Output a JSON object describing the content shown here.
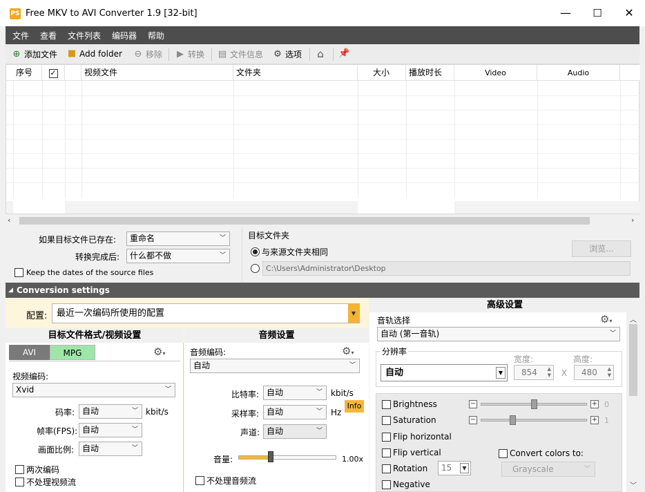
{
  "window": {
    "title": "Free MKV to AVI Converter 1.9  [32-bit]",
    "icon_text": "PS",
    "minimize": "—",
    "maximize": "☐",
    "close": "✕"
  },
  "menu": [
    "文件",
    "查看",
    "文件列表",
    "编码器",
    "帮助"
  ],
  "toolbar": {
    "add_file": "添加文件",
    "add_folder": "Add folder",
    "remove": "移除",
    "convert": "转换",
    "file_info": "文件信息",
    "options": "选项"
  },
  "table": {
    "columns": [
      "序号",
      "",
      "",
      "视频文件",
      "文件夹",
      "大小",
      "播放时长",
      "Video",
      "Audio"
    ]
  },
  "options": {
    "if_exists_label": "如果目标文件已存在:",
    "if_exists_value": "重命名",
    "after_done_label": "转换完成后:",
    "after_done_value": "什么都不做",
    "keep_dates": "Keep the dates of the source files",
    "target_folder_label": "目标文件夹",
    "same_as_source": "与来源文件夹相同",
    "custom_path": "C:\\Users\\Administrator\\Desktop",
    "browse": "浏览..."
  },
  "conversion": {
    "band_title": "Conversion settings",
    "profile_label": "配置:",
    "profile_value": "最近一次编码所使用的配置",
    "video": {
      "section_title": "目标文件格式/视频设置",
      "tab_avi": "AVI",
      "tab_mpg": "MPG",
      "codec_label": "视频编码:",
      "codec_value": "Xvid",
      "bitrate_label": "码率:",
      "bitrate_value": "自动",
      "bitrate_unit": "kbit/s",
      "fps_label": "帧率(FPS):",
      "fps_value": "自动",
      "aspect_label": "画面比例:",
      "aspect_value": "自动",
      "two_pass": "两次编码",
      "no_video": "不处理视频流"
    },
    "audio": {
      "section_title": "音频设置",
      "codec_label": "音频编码:",
      "codec_value": "自动",
      "bitrate_label": "比特率:",
      "bitrate_value": "自动",
      "bitrate_unit": "kbit/s",
      "info_badge": "Info",
      "samplerate_label": "采样率:",
      "samplerate_value": "自动",
      "samplerate_unit": "Hz",
      "channels_label": "声道:",
      "channels_value": "自动",
      "volume_label": "音量:",
      "volume_value": "1.00x",
      "volume_level": 0.33,
      "no_audio": "不处理音频流"
    },
    "advanced": {
      "section_title": "高级设置",
      "audio_track_label": "音轨选择",
      "audio_track_value": "自动 (第一音轨)",
      "resolution_label": "分辨率",
      "resolution_value": "自动",
      "width_label": "宽度:",
      "width_value": "854",
      "height_label": "高度:",
      "height_value": "480",
      "times": "X",
      "brightness": "Brightness",
      "brightness_value": "0",
      "brightness_level": 0.5,
      "saturation": "Saturation",
      "saturation_value": "1",
      "saturation_level": 0.3,
      "flip_horizontal": "Flip horizontal",
      "flip_vertical": "Flip vertical",
      "convert_colors": "Convert colors to:",
      "convert_colors_value": "Grayscale",
      "rotation": "Rotation",
      "rotation_value": "15",
      "negative": "Negative"
    }
  }
}
